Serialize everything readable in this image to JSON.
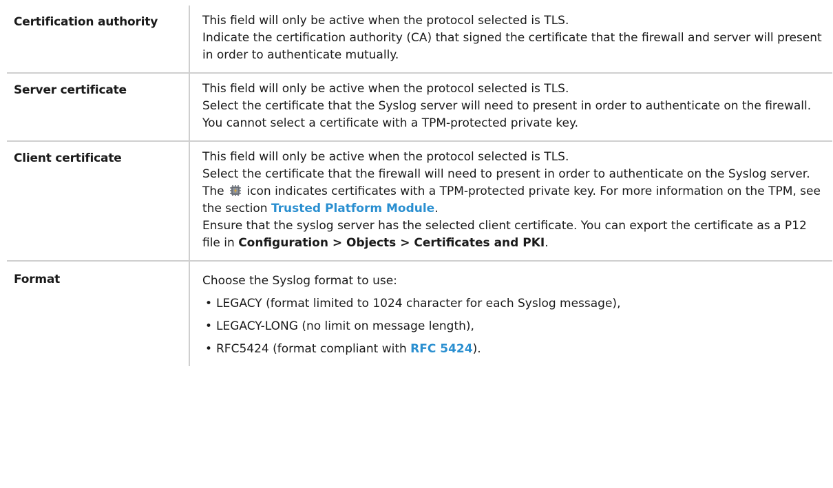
{
  "rows": [
    {
      "term": "Certification authority",
      "lines": [
        "This field will only be active when the protocol selected is TLS.",
        "Indicate the certification authority (CA) that signed the certificate that the firewall and server will present in order to authenticate mutually."
      ]
    },
    {
      "term": "Server certificate",
      "lines": [
        "This field will only be active when the protocol selected is TLS.",
        "Select the certificate that the Syslog server will need to present in order to authenticate on the firewall.",
        "You cannot select a certificate with a TPM-protected private key."
      ]
    },
    {
      "term": "Client certificate",
      "line1": "This field will only be active when the protocol selected is TLS.",
      "line2": "Select the certificate that the firewall will need to present in order to authenticate on the Syslog server.",
      "tpm_pre": "The",
      "tpm_post": " icon indicates certificates with a TPM-protected private key. For more information on the TPM, see the section ",
      "tpm_link": "Trusted Platform Module",
      "tpm_end": ".",
      "export_pre": "Ensure that the syslog server has the selected client certificate. You can export the certificate as a P12 file in ",
      "export_path": "Configuration > Objects > Certificates and PKI",
      "export_end": "."
    },
    {
      "term": "Format",
      "lead": "Choose the Syslog format to use:",
      "items": [
        {
          "text": "LEGACY (format limited to 1024 character for each Syslog message),"
        },
        {
          "text": "LEGACY-LONG (no limit on message length),"
        },
        {
          "pre": "RFC5424 (format compliant with ",
          "link": "RFC 5424",
          "post": ")."
        }
      ]
    }
  ],
  "icons": {
    "tpm": "chip-icon"
  },
  "colors": {
    "link": "#2a8fd0",
    "border": "#cfcfcf"
  }
}
